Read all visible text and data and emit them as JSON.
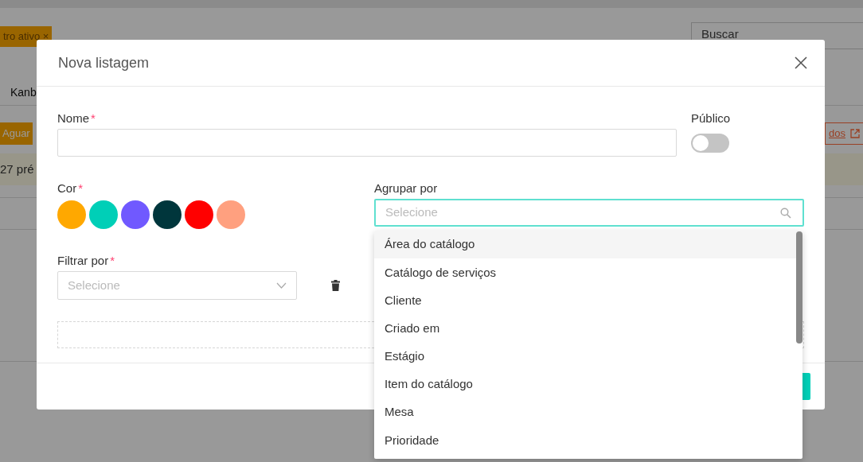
{
  "background": {
    "filter_badge": "tro ativo ×",
    "search": {
      "placeholder": "Buscar"
    },
    "view_label": "Kanb",
    "status_badge": "Aguar",
    "link": "dos",
    "count_text": "27 pré"
  },
  "modal": {
    "title": "Nova listagem",
    "name_field": {
      "label": "Nome",
      "required_mark": "*"
    },
    "public_toggle": {
      "label": "Público",
      "on": false
    },
    "color_field": {
      "label": "Cor",
      "required_mark": "*",
      "swatches": [
        {
          "color": "#ffa800"
        },
        {
          "color": "#00cfb7"
        },
        {
          "color": "#7059ff"
        },
        {
          "color": "#00363c"
        },
        {
          "color": "#ff0000"
        },
        {
          "color": "#ffa07f"
        }
      ]
    },
    "group_by": {
      "label": "Agrupar por",
      "placeholder": "Selecione",
      "expanded": true,
      "options": [
        {
          "label": "Área do catálogo",
          "highlighted": true
        },
        {
          "label": "Catálogo de serviços",
          "highlighted": false
        },
        {
          "label": "Cliente",
          "highlighted": false
        },
        {
          "label": "Criado em",
          "highlighted": false
        },
        {
          "label": "Estágio",
          "highlighted": false
        },
        {
          "label": "Item do catálogo",
          "highlighted": false
        },
        {
          "label": "Mesa",
          "highlighted": false
        },
        {
          "label": "Prioridade",
          "highlighted": false
        }
      ]
    },
    "filter_by": {
      "label": "Filtrar por",
      "required_mark": "*",
      "placeholder": "Selecione"
    }
  }
}
